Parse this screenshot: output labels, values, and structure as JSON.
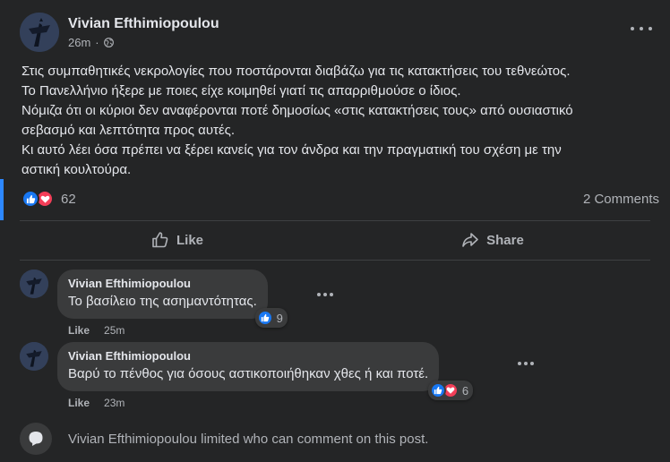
{
  "post": {
    "author": "Vivian Efthimiopoulou",
    "time": "26m",
    "privacy_icon": "globe-icon",
    "text_lines": [
      "Στις συμπαθητικές νεκρολογίες που ποστάρονται διαβάζω για τις κατακτήσεις του τεθνεώτος.",
      "Το Πανελλήνιο ήξερε με ποιες είχε κοιμηθεί γιατί τις απαρριθμούσε ο ίδιος.",
      "Νόμιζα ότι οι κύριοι δεν αναφέρονται ποτέ δημοσίως «στις κατακτήσεις τους» από ουσιαστικό",
      "σεβασμό και λεπτότητα προς αυτές.",
      "Κι αυτό λέει όσα πρέπει να ξέρει κανείς για τον άνδρα και την πραγματική του σχέση με την",
      "αστική κουλτούρα."
    ],
    "reactions_count": "62",
    "comments_label": "2 Comments"
  },
  "actions": {
    "like_label": "Like",
    "share_label": "Share"
  },
  "comments": [
    {
      "author": "Vivian Efthimiopoulou",
      "text": "Το βασίλειο της ασημαντότητας.",
      "reaction_count": "9",
      "like_label": "Like",
      "time": "25m"
    },
    {
      "author": "Vivian Efthimiopoulou",
      "text": "Βαρύ το πένθος για όσους αστικοποιήθηκαν χθες ή και ποτέ.",
      "reaction_count": "6",
      "like_label": "Like",
      "time": "23m"
    }
  ],
  "limited_notice": "Vivian Efthimiopoulou limited who can comment on this post.",
  "colors": {
    "background": "#242526",
    "bubble": "#3a3b3c",
    "like_blue": "#1877f2",
    "love_red": "#f33e58",
    "accent": "#2d88ff"
  }
}
